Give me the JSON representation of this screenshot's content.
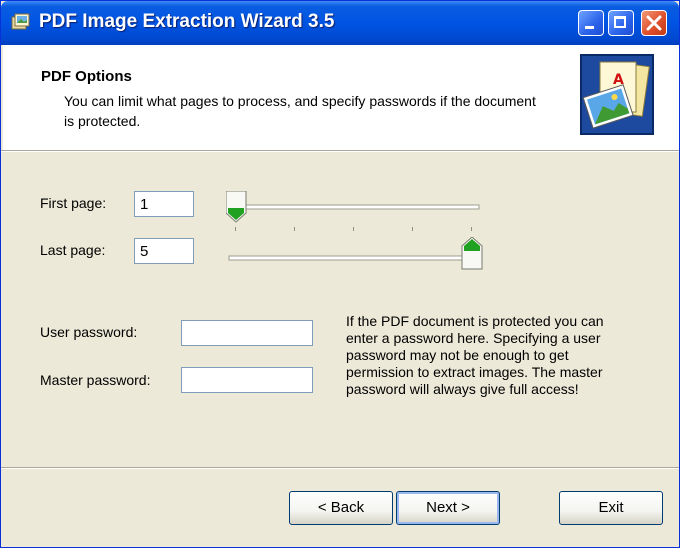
{
  "window": {
    "title": "PDF Image Extraction Wizard 3.5"
  },
  "header": {
    "title": "PDF Options",
    "description": "You can limit what pages to process, and specify passwords if the document is protected."
  },
  "pages": {
    "first_label": "First page:",
    "first_value": "1",
    "last_label": "Last page:",
    "last_value": "5",
    "range_min": 1,
    "range_max": 5
  },
  "passwords": {
    "user_label": "User password:",
    "user_value": "",
    "master_label": "Master password:",
    "master_value": "",
    "info_text": "If the PDF document is protected you can enter a password here. Specifying a user password may not be enough to get permission to extract images. The master password will always give full access!"
  },
  "buttons": {
    "back": "< Back",
    "next": "Next >",
    "exit": "Exit"
  },
  "colors": {
    "titlebar": "#0054e3",
    "dialog_bg": "#ece9d8",
    "slider_thumb": "#21a121"
  }
}
